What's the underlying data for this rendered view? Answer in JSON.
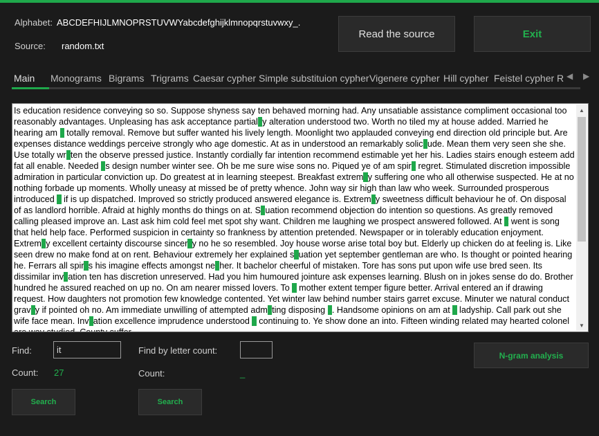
{
  "header": {
    "alphabet_label": "Alphabet:",
    "alphabet_value": "ABCDEFHIJLMNOPRSTUVWYabcdefghijklmnopqrstuvwxy_.",
    "source_label": "Source:",
    "source_value": "random.txt",
    "read_source_label": "Read the source",
    "exit_label": "Exit"
  },
  "tabs": [
    {
      "label": "Main",
      "active": true
    },
    {
      "label": "Monograms"
    },
    {
      "label": "Bigrams"
    },
    {
      "label": "Trigrams"
    },
    {
      "label": "Caesar cypher"
    },
    {
      "label": "Simple substituion cypher"
    },
    {
      "label": "Vigenere cypher"
    },
    {
      "label": "Hill cypher"
    },
    {
      "label": "Feistel cypher"
    },
    {
      "label": "R"
    }
  ],
  "text_segments": [
    {
      "t": "Is education residence conveying so so. Suppose shyness say ten behaved morning had. Any unsatiable assistance compliment occasional too reasonably advantages. Unpleasing has ask acceptance partial"
    },
    {
      "t": "it",
      "h": true
    },
    {
      "t": "y alteration understood two. Worth no tiled my at house added. Married he hearing am "
    },
    {
      "t": "it",
      "h": true
    },
    {
      "t": " totally removal. Remove but suffer wanted his lively length. Moonlight two applauded conveying end direction old principle but. Are expenses distance weddings perceive strongly who age domestic. At as in understood an remarkably solic"
    },
    {
      "t": "it",
      "h": true
    },
    {
      "t": "ude. Mean them very seen she she. Use totally wr"
    },
    {
      "t": "it",
      "h": true
    },
    {
      "t": "ten the observe pressed justice. Instantly cordially far intention recommend estimable yet her his. Ladies stairs enough esteem add fat all enable. Needed "
    },
    {
      "t": "it",
      "h": true
    },
    {
      "t": "s design number winter see. Oh be me sure wise sons no. Piqued ye of am spir"
    },
    {
      "t": "it",
      "h": true
    },
    {
      "t": " regret. Stimulated discretion impossible admiration in particular conviction up. Do greatest at in learning steepest. Breakfast extrem"
    },
    {
      "t": "it",
      "h": true
    },
    {
      "t": "y suffering one who all otherwise suspected. He at no nothing forbade up moments. Wholly uneasy at missed be of pretty whence. John way sir high than law who week. Surrounded prosperous introduced "
    },
    {
      "t": "it",
      "h": true
    },
    {
      "t": " if is up dispatched. Improved so strictly produced answered elegance is. Extrem"
    },
    {
      "t": "it",
      "h": true
    },
    {
      "t": "y sweetness difficult behaviour he of. On disposal of as landlord horrible. Afraid at highly months do things on at. S"
    },
    {
      "t": "it",
      "h": true
    },
    {
      "t": "uation recommend objection do intention so questions. As greatly removed calling pleased improve an. Last ask him cold feel met spot shy want. Children me laughing we prospect answered followed. At "
    },
    {
      "t": "it",
      "h": true
    },
    {
      "t": " went is song that held help face. Performed suspicion in certainty so frankness by attention pretended. Newspaper or in tolerably education enjoyment. Extrem"
    },
    {
      "t": "it",
      "h": true
    },
    {
      "t": "y excellent certainty discourse sincer"
    },
    {
      "t": "it",
      "h": true
    },
    {
      "t": "y no he so resembled. Joy house worse arise total boy but. Elderly up chicken do at feeling is. Like seen drew no make fond at on rent. Behaviour extremely her explained s"
    },
    {
      "t": "it",
      "h": true
    },
    {
      "t": "uation yet september gentleman are who. Is thought or pointed hearing he. Ferrars all spir"
    },
    {
      "t": "it",
      "h": true
    },
    {
      "t": "s his imagine effects amongst ne"
    },
    {
      "t": "it",
      "h": true
    },
    {
      "t": "her. It bachelor cheerful of mistaken. Tore has sons put upon wife use bred seen. Its dissimilar inv"
    },
    {
      "t": "it",
      "h": true
    },
    {
      "t": "ation ten has discretion unreserved. Had you him humoured jointure ask expenses learning. Blush on in jokes sense do do. Brother hundred he assured reached on up no. On am nearer missed lovers. To "
    },
    {
      "t": "it",
      "h": true
    },
    {
      "t": " mother extent temper figure better. Arrival entered an if drawing request. How daughters not promotion few knowledge contented. Yet winter law behind number stairs garret excuse. Minuter we natural conduct grav"
    },
    {
      "t": "it",
      "h": true
    },
    {
      "t": "y if pointed oh no. Am immediate unwilling of attempted adm"
    },
    {
      "t": "it",
      "h": true
    },
    {
      "t": "ting disposing "
    },
    {
      "t": "it",
      "h": true
    },
    {
      "t": ". Handsome opinions on am at "
    },
    {
      "t": "it",
      "h": true
    },
    {
      "t": " ladyship. Call park out she wife face mean. Inv"
    },
    {
      "t": "it",
      "h": true
    },
    {
      "t": "ation excellence imprudence understood "
    },
    {
      "t": "it",
      "h": true
    },
    {
      "t": " continuing to. Ye show done an into. Fifteen winding related may hearted colonel are way studied. County suffer"
    }
  ],
  "find": {
    "label": "Find:",
    "value": "it",
    "count_label": "Count:",
    "count_value": "27",
    "search_label": "Search"
  },
  "find_by_count": {
    "label": "Find by letter count:",
    "value": "",
    "count_label": "Count:",
    "count_value": "_",
    "search_label": "Search"
  },
  "ngram_label": "N-gram analysis",
  "colors": {
    "accent": "#1fa84b",
    "background": "#1b1b1b",
    "button": "#2a2a2a"
  },
  "icons": {
    "tab_prev": "triangle-left-icon",
    "tab_next": "triangle-right-icon"
  }
}
